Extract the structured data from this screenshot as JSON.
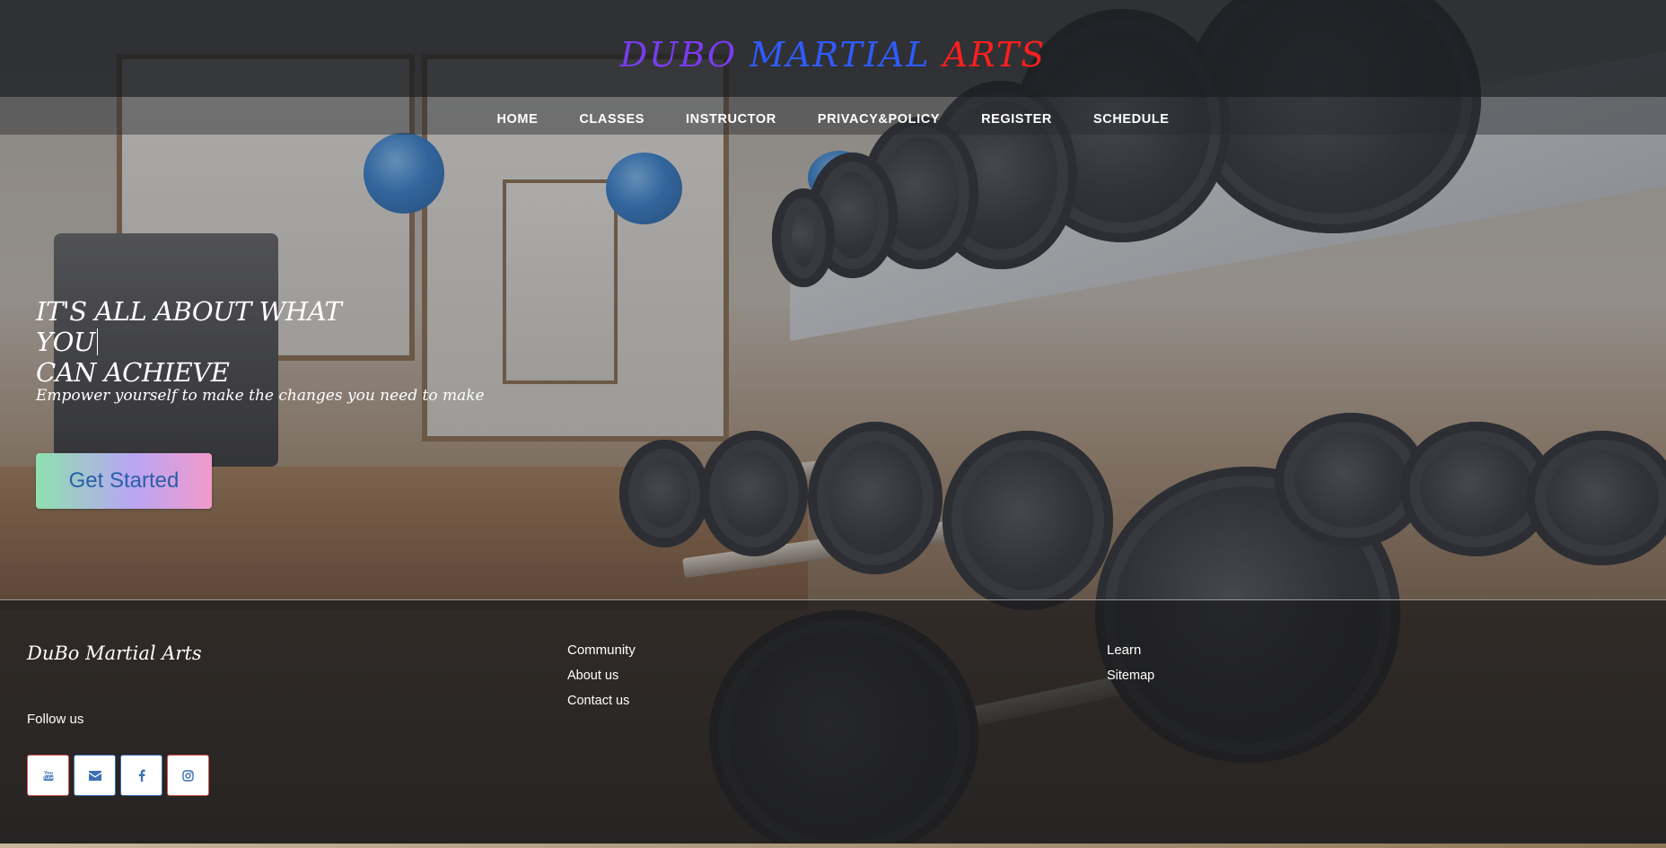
{
  "header": {
    "brand": {
      "word1": "DUBO",
      "word2": "MARTIAL",
      "word3": "ARTS",
      "colors": {
        "word1": "#7a3cf0",
        "word2": "#2f5bff",
        "word3": "#ff1f1f"
      }
    },
    "nav": [
      {
        "label": "HOME"
      },
      {
        "label": "CLASSES"
      },
      {
        "label": "INSTRUCTOR"
      },
      {
        "label": "PRIVACY&POLICY"
      },
      {
        "label": "REGISTER"
      },
      {
        "label": "SCHEDULE"
      }
    ]
  },
  "hero": {
    "title_line1": "IT'S ALL ABOUT WHAT YOU",
    "title_line2": "CAN ACHIEVE",
    "subtitle": "Empower yourself to make the changes you need to make",
    "cta_label": "Get Started",
    "cta_text_color": "#2b5fa8"
  },
  "footer": {
    "brand": "DuBo Martial Arts",
    "follow_label": "Follow us",
    "social": [
      {
        "icon": "youtube-icon"
      },
      {
        "icon": "envelope-icon"
      },
      {
        "icon": "facebook-icon"
      },
      {
        "icon": "instagram-icon"
      }
    ],
    "community": {
      "title": "Community",
      "links": [
        {
          "label": "About us"
        },
        {
          "label": "Contact us"
        }
      ]
    },
    "learn": {
      "title": "Learn",
      "links": [
        {
          "label": "Sitemap"
        }
      ]
    }
  }
}
